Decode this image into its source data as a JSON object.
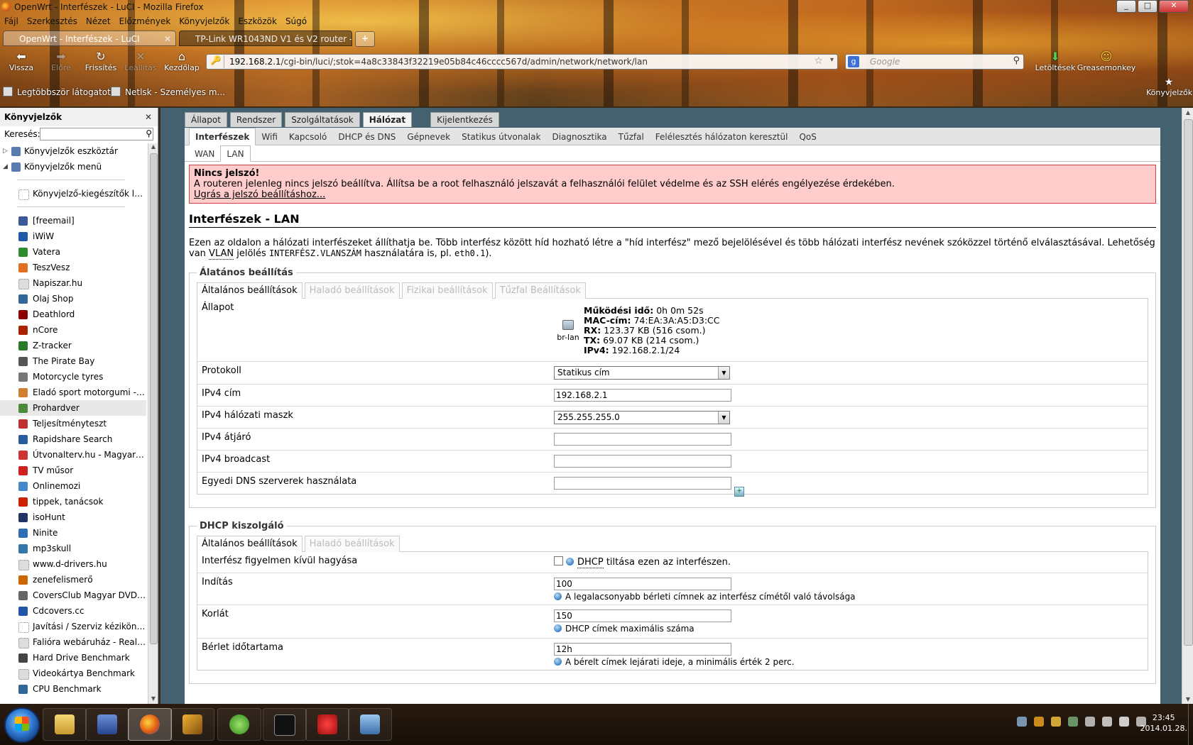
{
  "window": {
    "title": "OpenWrt - Interfészek - LuCI - Mozilla Firefox",
    "controls": [
      "_",
      "□",
      "✕"
    ]
  },
  "menubar": [
    "Fájl",
    "Szerkesztés",
    "Nézet",
    "Előzmények",
    "Könyvjelzők",
    "Eszközök",
    "Súgó"
  ],
  "tabs": [
    {
      "label": "OpenWrt - Interfészek - LuCI",
      "close": "✕"
    },
    {
      "label": "TP-Link WR1043ND V1 és V2 router - ..."
    }
  ],
  "newtab_label": "+",
  "nav": {
    "back": {
      "label": "Vissza",
      "glyph": "⬅"
    },
    "forward": {
      "label": "Előre",
      "glyph": "➡"
    },
    "reload": {
      "label": "Frissítés",
      "glyph": "↻"
    },
    "stop": {
      "label": "Leállítás",
      "glyph": "✕"
    },
    "home": {
      "label": "Kezdőlap",
      "glyph": "⌂"
    }
  },
  "urlbar": {
    "host": "192.168.2.1",
    "path": "/cgi-bin/luci/;stok=4a8c33843f32219e05b84c46cccc567d/admin/network/network/lan",
    "site_glyph": "🔑",
    "star_glyph": "☆",
    "dd_glyph": "▾"
  },
  "searchbar": {
    "engine_glyph": "g",
    "placeholder": "Google",
    "mag_glyph": "⚲"
  },
  "toolbar_right": [
    {
      "label": "Letöltések",
      "glyph": "⬇"
    },
    {
      "label": "Greasemonkey",
      "glyph": "☺"
    }
  ],
  "bookmarks_toolbar": {
    "items": [
      "Legtöbbször látogatott",
      "Netlsk - Személyes m..."
    ],
    "right_button": {
      "label": "Könyvjelzők",
      "glyph": "★"
    }
  },
  "sidebar": {
    "title": "Könyvjelzők",
    "close_glyph": "✕",
    "search_label": "Keresés:",
    "search_icon": "⚲",
    "folders": [
      {
        "label": "Könyvjelzők eszköztár",
        "twisty": "▷"
      },
      {
        "label": "Könyvjelzők menü",
        "twisty": "◢"
      }
    ],
    "special": "Könyvjelző-kiegészítők letölt...",
    "items": [
      {
        "label": "[freemail]",
        "color": "#3b5998"
      },
      {
        "label": "iWiW",
        "color": "#1e5aa8"
      },
      {
        "label": "Vatera",
        "color": "#2e8b2e"
      },
      {
        "label": "TeszVesz",
        "color": "#e07020"
      },
      {
        "label": "Napiszar.hu",
        "color": "#dddddd"
      },
      {
        "label": "Olaj Shop",
        "color": "#336699"
      },
      {
        "label": "Deathlord",
        "color": "#8b0000"
      },
      {
        "label": "nCore",
        "color": "#aa2200"
      },
      {
        "label": "Z-tracker",
        "color": "#2a7a2a"
      },
      {
        "label": "The Pirate Bay",
        "color": "#555555"
      },
      {
        "label": "Motorcycle tyres",
        "color": "#777777"
      },
      {
        "label": "Eladó sport motorgumi - Ké...",
        "color": "#d08030"
      },
      {
        "label": "Prohardver",
        "color": "#4a8a3a"
      },
      {
        "label": "Teljesítményteszt",
        "color": "#c03030"
      },
      {
        "label": "Rapidshare Search",
        "color": "#2a5aa0"
      },
      {
        "label": "Útvonalterv.hu - Magyarorsz...",
        "color": "#cc3333"
      },
      {
        "label": "TV műsor",
        "color": "#d02020"
      },
      {
        "label": "Onlinemozi",
        "color": "#4488cc"
      },
      {
        "label": "tippek, tanácsok",
        "color": "#cc2200"
      },
      {
        "label": "isoHunt",
        "color": "#223366"
      },
      {
        "label": "Ninite",
        "color": "#2d6db5"
      },
      {
        "label": "mp3skull",
        "color": "#3377aa"
      },
      {
        "label": "www.d-drivers.hu",
        "color": "#dddddd"
      },
      {
        "label": "zenefelismerő",
        "color": "#cc6600"
      },
      {
        "label": "CoversClub Magyar DVD bo...",
        "color": "#666666"
      },
      {
        "label": "Cdcovers.cc",
        "color": "#2255aa"
      },
      {
        "label": "Javítási / Szerviz kézikönyvek...",
        "color": "#ffffff"
      },
      {
        "label": "Falióra webáruház - Real Ma...",
        "color": "#dddddd"
      },
      {
        "label": "Hard Drive Benchmark",
        "color": "#444444"
      },
      {
        "label": "Videokártya Benchmark",
        "color": "#dddddd"
      },
      {
        "label": "CPU Benchmark",
        "color": "#336699"
      }
    ],
    "hover_item": "Prohardver"
  },
  "luci": {
    "top_tabs": [
      "Állapot",
      "Rendszer",
      "Szolgáltatások",
      "Hálózat",
      "Kijelentkezés"
    ],
    "active_top_tab": "Hálózat",
    "sub_tabs": [
      "Interfészek",
      "Wifi",
      "Kapcsoló",
      "DHCP és DNS",
      "Gépnevek",
      "Statikus útvonalak",
      "Diagnosztika",
      "Tűzfal",
      "Felélesztés hálózaton keresztül",
      "QoS"
    ],
    "active_sub_tab": "Interfészek",
    "iface_tabs": [
      "WAN",
      "LAN"
    ],
    "active_iface_tab": "LAN",
    "alert": {
      "title": "Nincs jelszó!",
      "text": "A routeren jelenleg nincs jelszó beállítva. Állítsa be a root felhasználó jelszavát a felhasználói felület védelme és az SSH elérés engélyezése érdekében.",
      "link": "Ugrás a jelszó beállításhoz..."
    },
    "page_title": "Interfészek - LAN",
    "description": {
      "part1": "Ezen az oldalon a hálózati interfészeket állíthatja be. Több interfész között híd hozható létre a \"híd interfész\" mező bejelölésével és több hálózati interfész nevének szóközzel történő elválasztásával. Lehetőség van",
      "vlan": "VLAN",
      "part2": " jelölés ",
      "mono1": "INTERFÉSZ.VLANSZÁM",
      "part3": " használatára is, pl. ",
      "mono2": "eth0.1",
      "part4": ")."
    },
    "general": {
      "legend": "Álatános beállítás",
      "tabs": [
        "Általános beállítások",
        "Haladó beállítások",
        "Fizikai beállítások",
        "Tűzfal Beállítások"
      ],
      "status_label": "Állapot",
      "iface_name": "br-lan",
      "status": [
        {
          "k": "Működési idő:",
          "v": "0h 0m 52s"
        },
        {
          "k": "MAC-cím:",
          "v": "74:EA:3A:A5:D3:CC"
        },
        {
          "k": "RX:",
          "v": "123.37 KB (516 csom.)"
        },
        {
          "k": "TX:",
          "v": "69.07 KB (214 csom.)"
        },
        {
          "k": "IPv4:",
          "v": "192.168.2.1/24"
        }
      ],
      "protocol_label": "Protokoll",
      "protocol_value": "Statikus cím",
      "ipv4_label": "IPv4 cím",
      "ipv4_value": "192.168.2.1",
      "mask_label": "IPv4 hálózati maszk",
      "mask_value": "255.255.255.0",
      "gateway_label": "IPv4 átjáró",
      "gateway_value": "",
      "broadcast_label": "IPv4 broadcast",
      "broadcast_value": "",
      "dns_label": "Egyedi DNS szerverek használata",
      "dns_value": "",
      "dns_add_glyph": "+"
    },
    "dhcp": {
      "legend": "DHCP kiszolgáló",
      "tabs": [
        "Általános beállítások",
        "Haladó beállítások"
      ],
      "ignore_label": "Interfész figyelmen kívül hagyása",
      "ignore_abbr": "DHCP",
      "ignore_hint": " tiltása ezen az interfészen.",
      "start_label": "Indítás",
      "start_value": "100",
      "start_hint": "A legalacsonyabb bérleti címnek az interfész címétől való távolsága",
      "limit_label": "Korlát",
      "limit_value": "150",
      "limit_hint": "DHCP címek maximális száma",
      "lease_label": "Bérlet időtartama",
      "lease_value": "12h",
      "lease_hint": "A bérelt címek lejárati ideje, a minimális érték 2 perc."
    }
  },
  "taskbar": {
    "apps": [
      "Windows Explorer",
      "Backup",
      "Firefox",
      "Tool",
      "uTorrent",
      "Terminal",
      "Paint",
      "Control Panel"
    ],
    "clock_time": "23:45",
    "clock_date": "2014.01.28."
  }
}
